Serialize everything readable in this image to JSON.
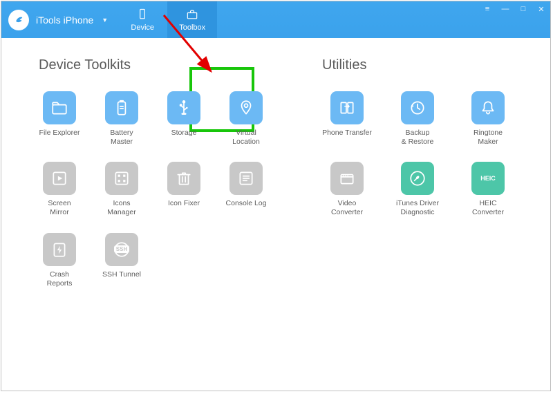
{
  "brand": {
    "name": "iTools iPhone"
  },
  "tabs": {
    "device": "Device",
    "toolbox": "Toolbox"
  },
  "sections": {
    "device_toolkits": "Device Toolkits",
    "utilities": "Utilities"
  },
  "device_toolkits": [
    {
      "label": "File Explorer",
      "icon": "folder",
      "state": "blue"
    },
    {
      "label": "Battery Master",
      "icon": "battery",
      "state": "blue"
    },
    {
      "label": "Storage",
      "icon": "usb",
      "state": "blue"
    },
    {
      "label": "Virtual Location",
      "icon": "pin",
      "state": "blue",
      "highlighted": true
    },
    {
      "label": "Screen Mirror",
      "icon": "play",
      "state": "gray"
    },
    {
      "label": "Icons Manager",
      "icon": "grid",
      "state": "gray"
    },
    {
      "label": "Icon Fixer",
      "icon": "trash",
      "state": "gray"
    },
    {
      "label": "Console Log",
      "icon": "clist",
      "state": "gray"
    },
    {
      "label": "Crash Reports",
      "icon": "bolt",
      "state": "gray"
    },
    {
      "label": "SSH Tunnel",
      "icon": "ssh",
      "state": "gray"
    }
  ],
  "utilities": [
    {
      "label": "Phone Transfer",
      "icon": "transfer",
      "state": "blue"
    },
    {
      "label": "Backup\n& Restore",
      "icon": "restore",
      "state": "blue"
    },
    {
      "label": "Ringtone Maker",
      "icon": "bell",
      "state": "blue"
    },
    {
      "label": "Video\nConverter",
      "icon": "video",
      "state": "gray"
    },
    {
      "label": "iTunes Driver\nDiagnostic",
      "icon": "wrench",
      "state": "green"
    },
    {
      "label": "HEIC Converter",
      "icon": "heic",
      "state": "green"
    }
  ],
  "colors": {
    "header": "#3ba2ec",
    "blue_tile": "#6cb9f4",
    "gray_tile": "#c8c8c8",
    "green_tile": "#4dc6a8",
    "highlight": "#18c60a",
    "arrow": "#e20000"
  }
}
